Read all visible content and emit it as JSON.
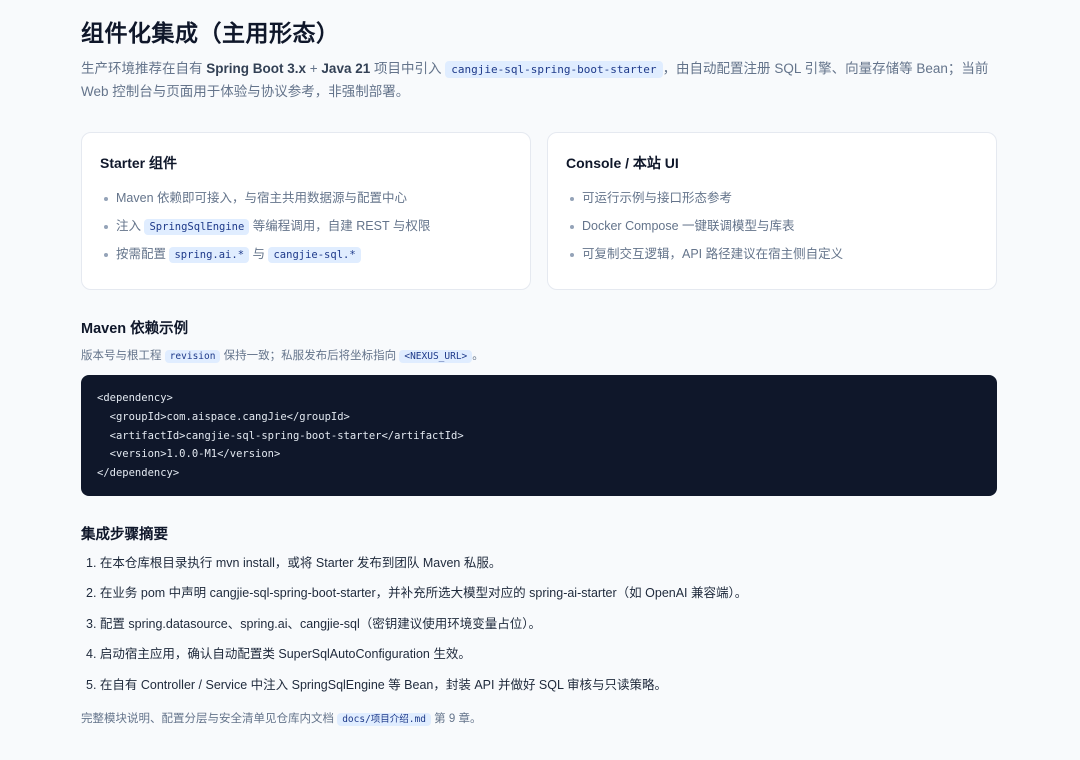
{
  "title": "组件化集成（主用形态）",
  "intro": {
    "p1": "生产环境推荐在自有 ",
    "b1": "Spring Boot 3.x",
    "p2": " + ",
    "b2": "Java 21",
    "p3": " 项目中引入 ",
    "code": "cangjie-sql-spring-boot-starter",
    "p4": "，由自动配置注册 SQL 引擎、向量存储等 Bean；当前 Web 控制台与页面用于体验与协议参考，非强制部署。"
  },
  "cards": {
    "starter": {
      "title": "Starter 组件",
      "item1": "Maven 依赖即可接入，与宿主共用数据源与配置中心",
      "item2_pre": "注入 ",
      "item2_code": "SpringSqlEngine",
      "item2_post": " 等编程调用，自建 REST 与权限",
      "item3_pre": "按需配置 ",
      "item3_code1": "spring.ai.*",
      "item3_mid": " 与 ",
      "item3_code2": "cangjie-sql.*"
    },
    "console": {
      "title": "Console / 本站 UI",
      "item1": "可运行示例与接口形态参考",
      "item2": "Docker Compose 一键联调模型与库表",
      "item3": "可复制交互逻辑，API 路径建议在宿主侧自定义"
    }
  },
  "maven": {
    "title": "Maven 依赖示例",
    "sub_pre": "版本号与根工程 ",
    "sub_code1": "revision",
    "sub_mid": " 保持一致；私服发布后将坐标指向 ",
    "sub_code2": "<NEXUS_URL>",
    "sub_post": "。",
    "code": "<dependency>\n  <groupId>com.aispace.cangJie</groupId>\n  <artifactId>cangjie-sql-spring-boot-starter</artifactId>\n  <version>1.0.0-M1</version>\n</dependency>"
  },
  "steps": {
    "title": "集成步骤摘要",
    "items": [
      "1. 在本仓库根目录执行 mvn install，或将 Starter 发布到团队 Maven 私服。",
      "2. 在业务 pom 中声明 cangjie-sql-spring-boot-starter，并补充所选大模型对应的 spring-ai-starter（如 OpenAI 兼容端）。",
      "3. 配置 spring.datasource、spring.ai、cangjie-sql（密钥建议使用环境变量占位）。",
      "4. 启动宿主应用，确认自动配置类 SuperSqlAutoConfiguration 生效。",
      "5. 在自有 Controller / Service 中注入 SpringSqlEngine 等 Bean，封装 API 并做好 SQL 审核与只读策略。"
    ]
  },
  "footer": {
    "pre": "完整模块说明、配置分层与安全清单见仓库内文档 ",
    "code": "docs/项目介绍.md",
    "post": " 第 9 章。"
  }
}
